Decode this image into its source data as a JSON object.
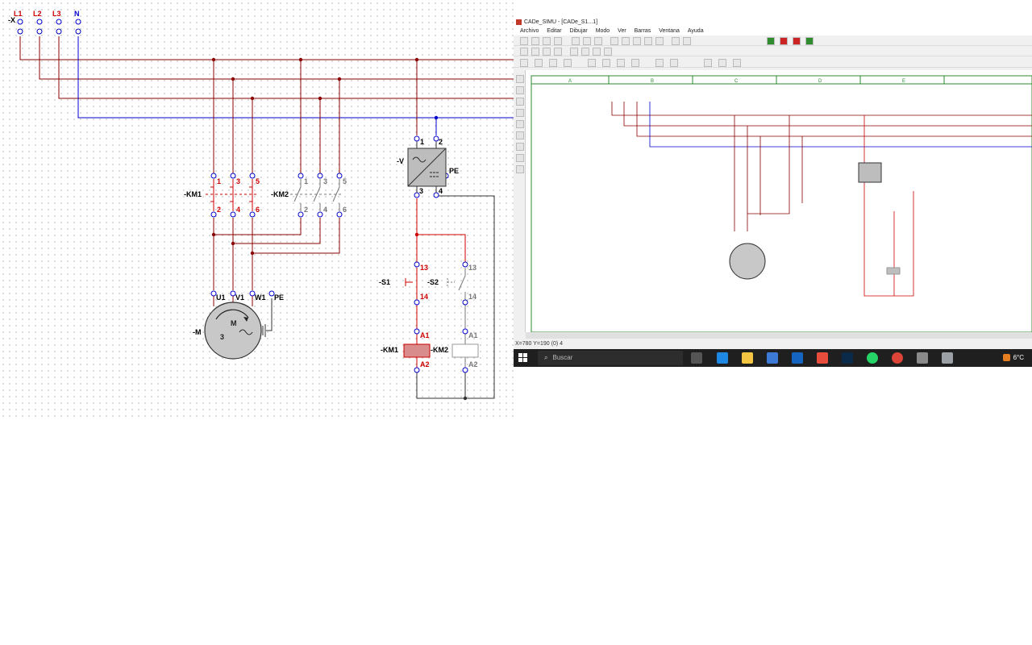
{
  "circuit": {
    "terminal_block": "-X",
    "phases": [
      "L1",
      "L2",
      "L3",
      "N"
    ],
    "km1": {
      "name": "-KM1",
      "top": [
        "1",
        "3",
        "5"
      ],
      "bottom": [
        "2",
        "4",
        "6"
      ]
    },
    "km2": {
      "name": "-KM2",
      "top": [
        "1",
        "3",
        "5"
      ],
      "bottom": [
        "2",
        "4",
        "6"
      ]
    },
    "motor": {
      "name": "-M",
      "letter": "M",
      "phases_count": "3",
      "terminals": [
        "U1",
        "V1",
        "W1",
        "PE"
      ]
    },
    "psu": {
      "name": "-V",
      "top": [
        "1",
        "2"
      ],
      "bottom": [
        "3",
        "4"
      ],
      "pe": "PE"
    },
    "s1": {
      "name": "-S1",
      "top": "13",
      "bottom": "14"
    },
    "s2": {
      "name": "-S2",
      "top": "13",
      "bottom": "14"
    },
    "coil1": {
      "name": "-KM1",
      "a1": "A1",
      "a2": "A2"
    },
    "coil2": {
      "name": "-KM2",
      "a1": "A1",
      "a2": "A2"
    },
    "colors": {
      "phase": "#8b0000",
      "neutral": "#0000cc",
      "energized": "#cc0000",
      "idle": "#777777",
      "coil_on": "#d88c8c"
    }
  },
  "app": {
    "title": "CADe_SIMU - [CADe_S1...1]",
    "menu": [
      "Archivo",
      "Editar",
      "Dibujar",
      "Modo",
      "Ver",
      "Barras",
      "Ventana",
      "Ayuda"
    ],
    "columns": [
      "A",
      "B",
      "C",
      "D",
      "E"
    ],
    "status": "X=780 Y=190 (0) 4",
    "taskbar": {
      "search": "Buscar",
      "temperature": "6°C",
      "apps": [
        "task-view-icon",
        "edge-icon",
        "folder-icon",
        "store-icon",
        "mail-icon",
        "calc-icon",
        "photoshop-icon",
        "whatsapp-icon",
        "chrome-icon",
        "cadesimu-icon",
        "cadesimu2-icon"
      ]
    }
  }
}
